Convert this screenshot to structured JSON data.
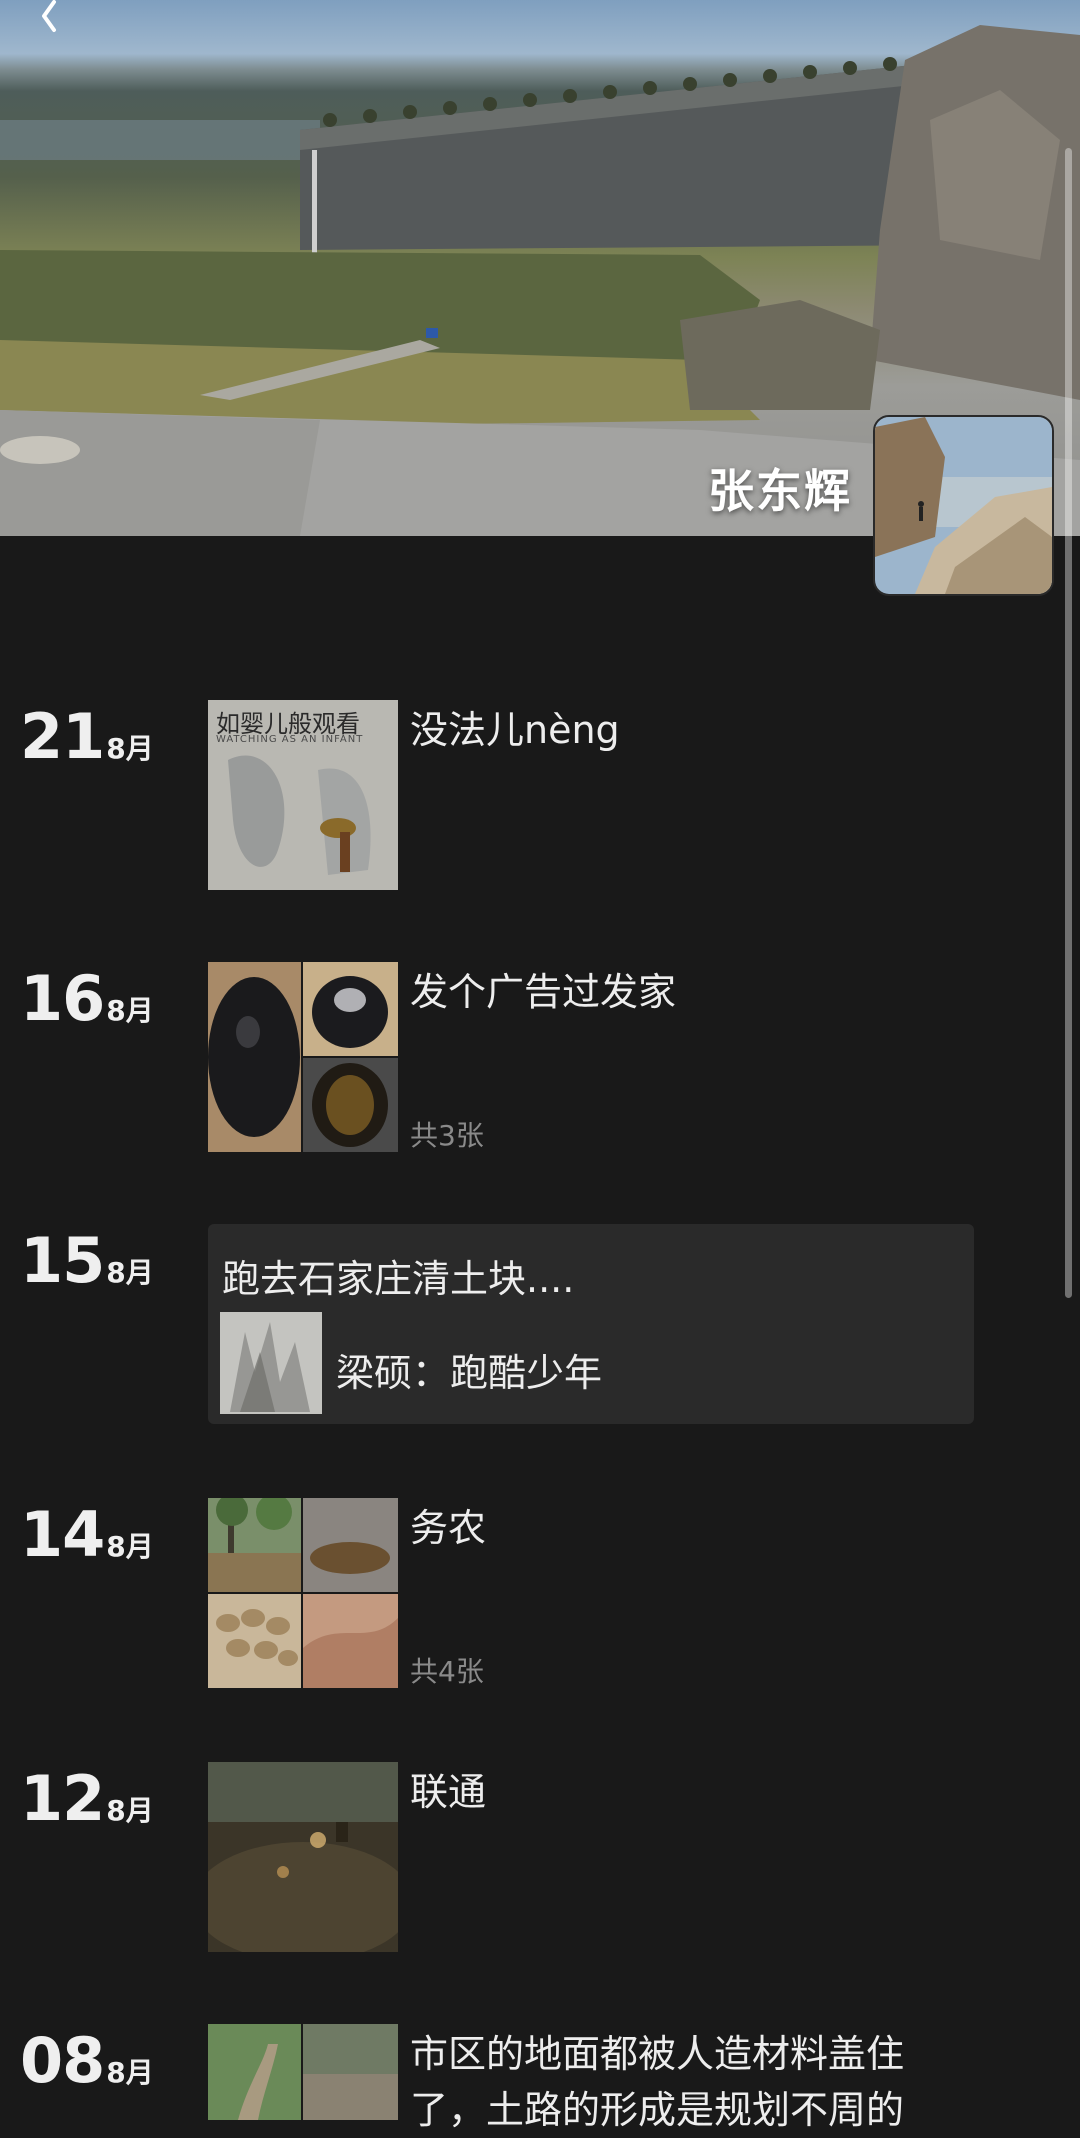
{
  "profile": {
    "name": "张东辉"
  },
  "icons": {
    "back": "chevron-left-icon"
  },
  "posts": [
    {
      "day": "21",
      "month": "8月",
      "text": "没法儿nèng",
      "thumb_caption_cn": "如婴儿般观看",
      "thumb_caption_en": "WATCHING AS AN INFANT"
    },
    {
      "day": "16",
      "month": "8月",
      "text": "发个广告过发家",
      "count": "共3张"
    },
    {
      "day": "15",
      "month": "8月",
      "share_title": "跑去石家庄清土块....",
      "share_sub": "梁硕：跑酷少年"
    },
    {
      "day": "14",
      "month": "8月",
      "text": "务农",
      "count": "共4张"
    },
    {
      "day": "12",
      "month": "8月",
      "text": "联通"
    },
    {
      "day": "08",
      "month": "8月",
      "text_line1": "市区的地面都被人造材料盖住",
      "text_line2": "了，土路的形成是规划不周的"
    }
  ],
  "colors": {
    "background": "#191919",
    "text": "#ededed",
    "muted": "#8a8a8a",
    "share_card": "#2a2a2a"
  }
}
